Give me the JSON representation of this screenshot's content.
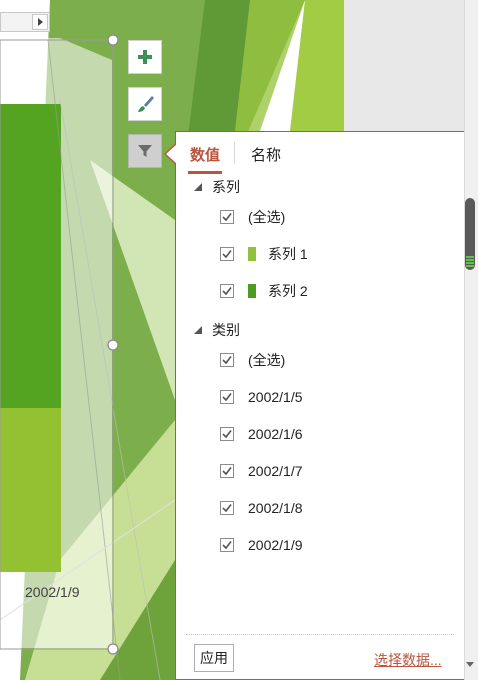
{
  "chart": {
    "axis_label": "2002/1/9",
    "buttons": [
      {
        "icon": "plus-icon"
      },
      {
        "icon": "brush-icon"
      },
      {
        "icon": "filter-icon"
      }
    ]
  },
  "filter_panel": {
    "tabs": [
      {
        "label": "数值"
      },
      {
        "label": "名称"
      }
    ],
    "series_header": "系列",
    "series_items": [
      {
        "label": "(全选)",
        "checked": true
      },
      {
        "label": "系列 1",
        "checked": true,
        "color": "#92c13e"
      },
      {
        "label": "系列 2",
        "checked": true,
        "color": "#4e9a24"
      }
    ],
    "category_header": "类别",
    "category_items": [
      {
        "label": "(全选)",
        "checked": true
      },
      {
        "label": "2002/1/5",
        "checked": true
      },
      {
        "label": "2002/1/6",
        "checked": true
      },
      {
        "label": "2002/1/7",
        "checked": true
      },
      {
        "label": "2002/1/8",
        "checked": true
      },
      {
        "label": "2002/1/9",
        "checked": true
      }
    ],
    "apply_label": "应用",
    "select_data_label": "选择数据..."
  },
  "colors": {
    "accent": "#b9553d",
    "green_dark": "#4e9a24",
    "green_light": "#92c13e"
  }
}
